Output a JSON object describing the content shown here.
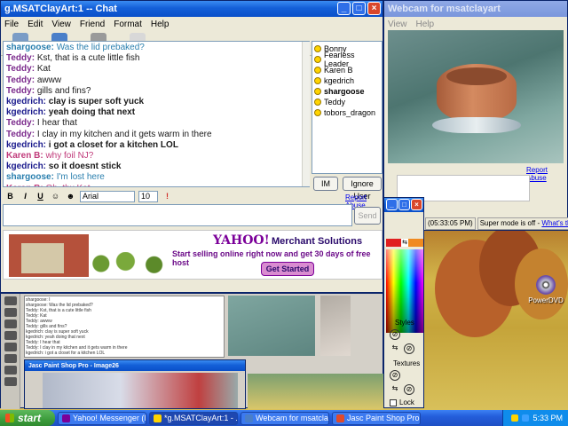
{
  "chat_window": {
    "title": "g.MSATClayArt:1 -- Chat",
    "menu": [
      "File",
      "Edit",
      "View",
      "Friend",
      "Format",
      "Help"
    ],
    "toolbar": [
      {
        "label": "Send File",
        "icon": "send-file-icon",
        "color": "#7a9cc6"
      },
      {
        "label": "Webcam",
        "icon": "webcam-icon",
        "color": "#4a7fc9"
      },
      {
        "label": "Voice",
        "icon": "voice-icon",
        "color": "#9a9a9a"
      },
      {
        "label": "Chat",
        "icon": "chat-icon",
        "color": "#d8d8d8"
      }
    ],
    "messages": [
      {
        "nick": "shargoose:",
        "text": "Was the lid prebaked?",
        "color": "#2a7fae"
      },
      {
        "nick": "Teddy:",
        "text": "Kst, that is a cute little fish",
        "color": "#7b2a8c"
      },
      {
        "nick": "Teddy:",
        "text": "Kat",
        "color": "#7b2a8c"
      },
      {
        "nick": "Teddy:",
        "text": "awww",
        "color": "#7b2a8c"
      },
      {
        "nick": "Teddy:",
        "text": "gills and fins?",
        "color": "#7b2a8c"
      },
      {
        "nick": "kgedrich:",
        "text": "clay is super soft yuck",
        "color": "#1a1a8c"
      },
      {
        "nick": "kgedrich:",
        "text": "yeah doing that next",
        "color": "#1a1a8c"
      },
      {
        "nick": "Teddy:",
        "text": "I hear that",
        "color": "#7b2a8c"
      },
      {
        "nick": "Teddy:",
        "text": "I clay in my kitchen and it gets warm in there",
        "color": "#7b2a8c"
      },
      {
        "nick": "kgedrich:",
        "text": "i got a closet for a kitchen LOL",
        "color": "#1a1a8c"
      },
      {
        "nick": "Karen B:",
        "text": "why foil NJ?",
        "color": "#c03a7a"
      },
      {
        "nick": "kgedrich:",
        "text": "so it doesnt stick",
        "color": "#1a1a8c"
      },
      {
        "nick": "shargoose:",
        "text": "I'm lost here",
        "color": "#2a7fae"
      },
      {
        "nick": "Karen B:",
        "text": "Oh, thx Kat",
        "color": "#c03a7a"
      }
    ],
    "users": [
      {
        "name": "Bonny",
        "bold": false
      },
      {
        "name": "Fearless Leader",
        "bold": false
      },
      {
        "name": "Karen B",
        "bold": false
      },
      {
        "name": "kgedrich",
        "bold": false
      },
      {
        "name": "shargoose",
        "bold": true
      },
      {
        "name": "Teddy",
        "bold": false
      },
      {
        "name": "tobors_dragon",
        "bold": false
      }
    ],
    "im_button": "IM",
    "ignore_button": "Ignore User",
    "format": {
      "bold": "B",
      "italic": "I",
      "underline": "U",
      "font": "Arial",
      "size": "10"
    },
    "report_abuse": "Report Abuse",
    "send_button": "Send",
    "ad": {
      "brand": "YAHOO!",
      "product": "Merchant Solutions",
      "tagline": "Start selling online right now and get 30 days of free host",
      "cta": "Get Started"
    }
  },
  "webcam_window": {
    "title": "Webcam for msatclayart",
    "menu": [
      "View",
      "Help"
    ],
    "report_abuse": "Report Abuse",
    "timestamp": "(05:33:05 PM)",
    "status": "Super mode is off -",
    "whats_this": "What's this?"
  },
  "paint_shop": {
    "inner_title": "Jasc Paint Shop Pro - Image26",
    "chat_preview": [
      "shargoose: I",
      "shargoose: Was the lid prebaked?",
      "Teddy: Kst, that is a cute little fish",
      "Teddy: Kat",
      "Teddy: awww",
      "Teddy: gills and fins?",
      "kgedrich: clay is super soft yuck",
      "kgedrich: yeah doing that next",
      "Teddy: I hear that",
      "Teddy: I clay in my kitchen and it gets warm in there",
      "kgedrich: i got a closet for a kitchen LOL"
    ]
  },
  "palette": {
    "styles_label": "Styles",
    "textures_label": "Textures",
    "lock_label": "Lock"
  },
  "desktop_icon": {
    "label": "PowerDVD"
  },
  "taskbar": {
    "start": "start",
    "tasks": [
      {
        "label": "Yahoo! Messenger (I...",
        "color": "#7b0099",
        "active": false
      },
      {
        "label": "*g.MSATClayArt:1 - ...",
        "color": "#ffd400",
        "active": true
      },
      {
        "label": "Webcam for msatclay...",
        "color": "#4a7fc9",
        "active": false
      },
      {
        "label": "Jasc Paint Shop Pro - ...",
        "color": "#e04a2a",
        "active": false
      }
    ],
    "clock": "5:33 PM"
  }
}
